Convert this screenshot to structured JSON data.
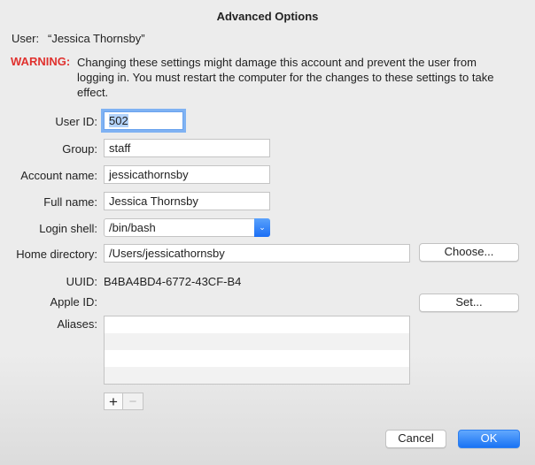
{
  "title": "Advanced Options",
  "user": {
    "label": "User:",
    "value": "“Jessica Thornsby”"
  },
  "warning": {
    "label": "WARNING:",
    "text": "Changing these settings might damage this account and prevent the user from logging in. You must restart the computer for the changes to these settings to take effect.",
    "color": "#e0312e"
  },
  "fields": {
    "user_id": {
      "label": "User ID:",
      "value": "502"
    },
    "group": {
      "label": "Group:",
      "value": "staff"
    },
    "account_name": {
      "label": "Account name:",
      "value": "jessicathornsby"
    },
    "full_name": {
      "label": "Full name:",
      "value": "Jessica Thornsby"
    },
    "login_shell": {
      "label": "Login shell:",
      "value": "/bin/bash"
    },
    "home_directory": {
      "label": "Home directory:",
      "value": "/Users/jessicathornsby"
    },
    "uuid": {
      "label": "UUID:",
      "value": "B4BA4BD4-6772-43CF-B4"
    },
    "apple_id": {
      "label": "Apple ID:",
      "value": ""
    },
    "aliases": {
      "label": "Aliases:"
    }
  },
  "buttons": {
    "choose": "Choose...",
    "set": "Set...",
    "add": "+",
    "remove": "−",
    "cancel": "Cancel",
    "ok": "OK"
  },
  "accent": "#1a82fb"
}
